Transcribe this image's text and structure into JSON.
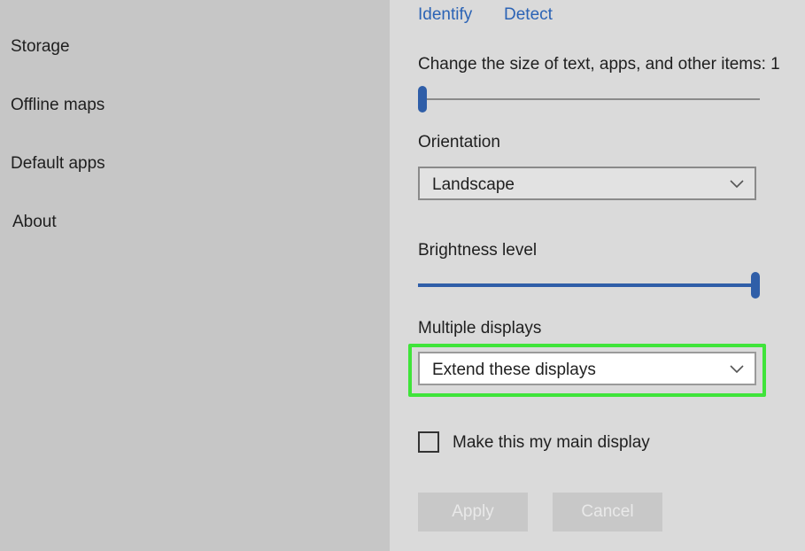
{
  "sidebar": {
    "items": [
      {
        "label": "Storage"
      },
      {
        "label": "Offline maps"
      },
      {
        "label": "Default apps"
      },
      {
        "label": "About"
      }
    ]
  },
  "links": {
    "identify": "Identify",
    "detect": "Detect"
  },
  "scale": {
    "label": "Change the size of text, apps, and other items: 1",
    "value_fraction": 0.0
  },
  "orientation": {
    "label": "Orientation",
    "value": "Landscape"
  },
  "brightness": {
    "label": "Brightness level",
    "value_fraction": 1.0
  },
  "multiple_displays": {
    "label": "Multiple displays",
    "value": "Extend these displays",
    "highlight_color": "#3fe43a"
  },
  "main_display": {
    "label": "Make this my main display",
    "checked": false
  },
  "buttons": {
    "apply": "Apply",
    "cancel": "Cancel"
  },
  "colors": {
    "accent": "#2f5ea8",
    "link": "#2b63b5",
    "sidebar_bg": "#c6c6c6",
    "main_bg": "#dadada"
  }
}
